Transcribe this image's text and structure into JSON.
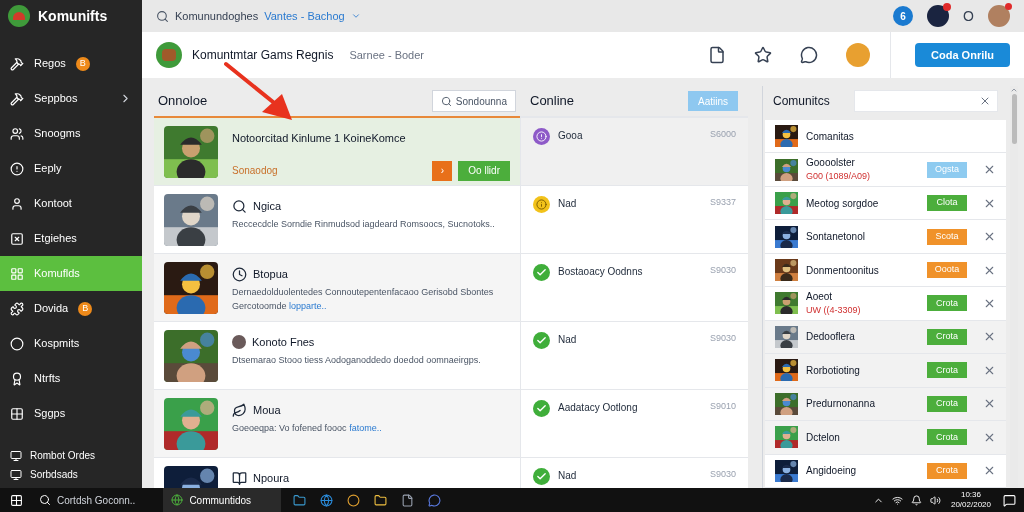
{
  "app": {
    "name": "Komunifts"
  },
  "sidebar": {
    "items": [
      {
        "label": "Regos",
        "badge": "B",
        "selected": false,
        "chevron": false
      },
      {
        "label": "Seppbos",
        "selected": false,
        "chevron": true
      },
      {
        "label": "Snoogms",
        "selected": false,
        "chevron": false
      },
      {
        "label": "Eeply",
        "selected": false,
        "chevron": false
      },
      {
        "label": "Kontoot",
        "selected": false,
        "chevron": false
      },
      {
        "label": "Etgiehes",
        "selected": false,
        "chevron": false
      },
      {
        "label": "Komuflds",
        "selected": true,
        "chevron": false
      },
      {
        "label": "Dovida",
        "badge": "B",
        "selected": false,
        "chevron": false
      },
      {
        "label": "Kospmits",
        "selected": false,
        "chevron": false
      },
      {
        "label": "Ntrfts",
        "selected": false,
        "chevron": false
      },
      {
        "label": "Sggps",
        "selected": false,
        "chevron": false
      }
    ],
    "footer": [
      "Rombot Ordes",
      "Sorbdsads"
    ]
  },
  "topbar": {
    "search": "Komunundoghes",
    "link": "Vantes - Bachog",
    "avatar_letter": "6",
    "ring_letter": "O"
  },
  "header": {
    "title": "Komuntmtar Gams Regnis",
    "subtitle": "Sarnee - Boder",
    "button": "Coda Onrilu"
  },
  "list": {
    "title": "Onnoloe",
    "search_button": "Sondounna",
    "rows": [
      {
        "title": "Notoorcitad Kinlume 1 KoineKomce",
        "status": "Sonaodog",
        "next": "›",
        "action": "Oo llidr",
        "selected": true
      },
      {
        "kind": "search",
        "title": "Ngica",
        "text": "Reccecdcle Sorndie Rinmudsod iagdeard Romsoocs, Sucnotoks..",
        "selected": false
      },
      {
        "kind": "clock",
        "title": "Btopua",
        "text": "Dernaedolduolentedes Connoutepentenfacaoo Gerisobd Sbontes Gercotoomde",
        "link": "lopparte..",
        "selected": false
      },
      {
        "kind": "avatar",
        "title": "Konoto Fnes",
        "text": "Dtsemarao Stooo tiess Aodoganoddedo doedod oomnaeirgps.",
        "selected": false
      },
      {
        "kind": "leaf",
        "title": "Moua",
        "text": "Goeoeqpa: Vo fofened foooc",
        "link": "fatome..",
        "selected": false
      },
      {
        "kind": "book",
        "title": "Npoura",
        "selected": false
      }
    ]
  },
  "online": {
    "title": "Conline",
    "button": "Aatiins",
    "rows": [
      {
        "kind": "alert",
        "label": "Gooa",
        "value": "S6000"
      },
      {
        "kind": "info",
        "label": "Nad",
        "value": "S9337"
      },
      {
        "kind": "check",
        "label": "Bostaoacy Oodnns",
        "value": "S9030"
      },
      {
        "kind": "check",
        "label": "Nad",
        "value": "S9030"
      },
      {
        "kind": "check",
        "label": "Aadatacy Ootlong",
        "value": "S9010"
      },
      {
        "kind": "check",
        "label": "Nad",
        "value": "S9030"
      }
    ]
  },
  "comments": {
    "title": "Comunitcs",
    "items": [
      {
        "name": "Comanitas"
      },
      {
        "name": "Goooolster",
        "note": "G00 (1089/A09)",
        "button": "Ogsta",
        "color": "#8ecbf0"
      },
      {
        "name": "Meotog sorgdoe",
        "button": "Clota",
        "color": "#4cae3c"
      },
      {
        "name": "Sontanetonol",
        "button": "Scota",
        "color": "#f0922a"
      },
      {
        "name": "Donmentoonitus",
        "button": "Ooota",
        "color": "#f0922a"
      },
      {
        "name": "Aoeot",
        "note": "UW ((4-3309)",
        "button": "Crota",
        "color": "#4cae3c"
      },
      {
        "name": "Dedooflera",
        "button": "Crota",
        "color": "#4cae3c"
      },
      {
        "name": "Rorbotioting",
        "button": "Crota",
        "color": "#4cae3c"
      },
      {
        "name": "Predurnonanna",
        "button": "Crota",
        "color": "#4cae3c"
      },
      {
        "name": "Dctelon",
        "button": "Crota",
        "color": "#4cae3c"
      },
      {
        "name": "Angidoeing",
        "button": "Crota",
        "color": "#f0922a"
      }
    ]
  },
  "taskbar": {
    "search": "Cortdsh Goconn..",
    "app": "Communtidos",
    "time": "10:36",
    "date": "20/02/2020"
  }
}
